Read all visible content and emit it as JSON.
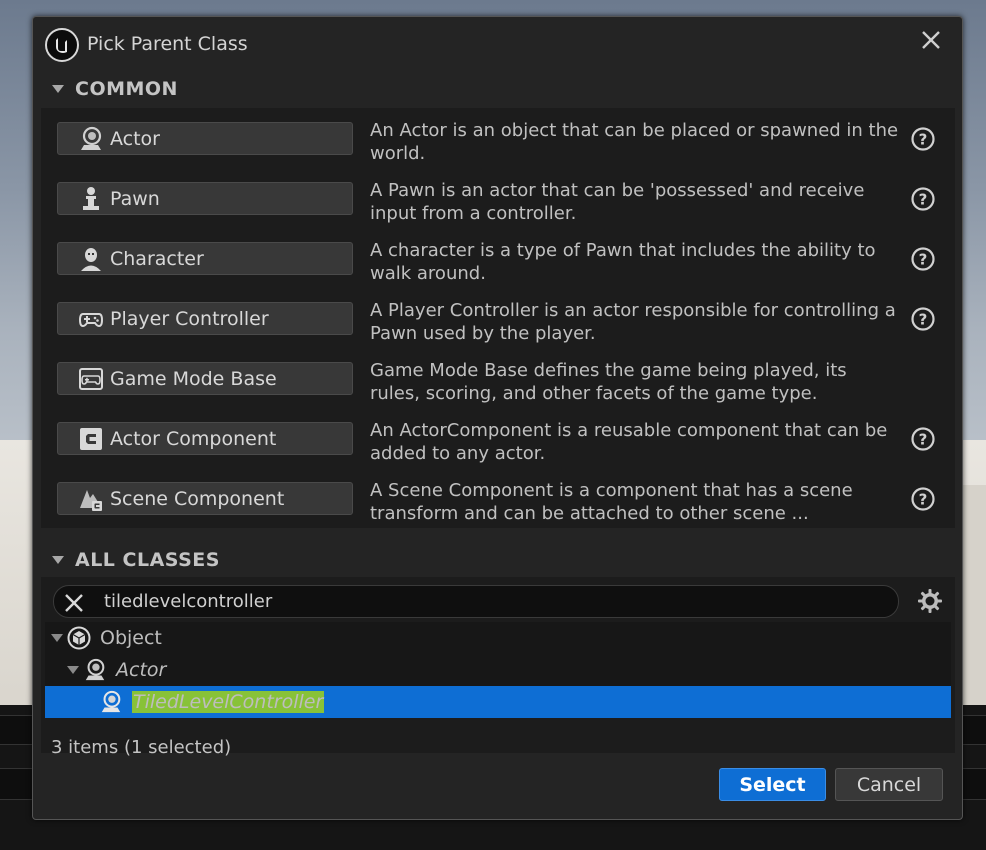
{
  "dialog": {
    "title": "Pick Parent Class",
    "close_icon": "close-icon"
  },
  "common": {
    "header": "COMMON",
    "items": [
      {
        "label": "Actor",
        "icon": "actor-icon",
        "description": "An Actor is an object that can be placed or spawned in the world.",
        "has_help": true
      },
      {
        "label": "Pawn",
        "icon": "pawn-icon",
        "description": "A Pawn is an actor that can be 'possessed' and receive input from a controller.",
        "has_help": true
      },
      {
        "label": "Character",
        "icon": "character-icon",
        "description": "A character is a type of Pawn that includes the ability to walk around.",
        "has_help": true
      },
      {
        "label": "Player Controller",
        "icon": "gamepad-icon",
        "description": "A Player Controller is an actor responsible for controlling a Pawn used by the player.",
        "has_help": true
      },
      {
        "label": "Game Mode Base",
        "icon": "game-mode-icon",
        "description": "Game Mode Base defines the game being played, its rules, scoring, and other facets of the game type.",
        "has_help": false
      },
      {
        "label": "Actor Component",
        "icon": "component-icon",
        "description": "An ActorComponent is a reusable component that can be added to any actor.",
        "has_help": true
      },
      {
        "label": "Scene Component",
        "icon": "scene-component-icon",
        "description": "A Scene Component is a component that has a scene transform and can be attached to other scene ...",
        "has_help": true
      }
    ]
  },
  "all_classes": {
    "header": "ALL CLASSES",
    "search_value": "tiledlevelcontroller",
    "tree": [
      {
        "label": "Object",
        "icon": "object-icon",
        "depth": 0,
        "expanded": true,
        "italic": false,
        "selected": false
      },
      {
        "label": "Actor",
        "icon": "actor-icon",
        "depth": 1,
        "expanded": true,
        "italic": true,
        "selected": false
      },
      {
        "label": "TiledLevelController",
        "icon": "actor-icon",
        "depth": 2,
        "expanded": false,
        "italic": true,
        "selected": true
      }
    ],
    "status": "3 items (1 selected)"
  },
  "buttons": {
    "select": "Select",
    "cancel": "Cancel"
  },
  "colors": {
    "accent": "#0e6ed4",
    "highlight": "#88c238",
    "dialog_bg": "#242424"
  }
}
